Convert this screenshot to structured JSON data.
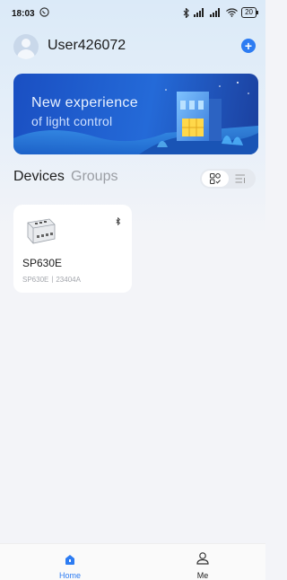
{
  "status_bar": {
    "time": "18:03",
    "battery": "20",
    "whatsapp_icon": "whatsapp-icon",
    "bluetooth_icon": "bluetooth-icon",
    "signal_icon": "signal-icon",
    "wifi_icon": "wifi-icon"
  },
  "header": {
    "username": "User426072",
    "add_label": "+"
  },
  "banner": {
    "line1": "New experience",
    "line2": "of light control"
  },
  "tabs": {
    "devices": "Devices",
    "groups": "Groups"
  },
  "devices": [
    {
      "name": "SP630E",
      "subtitle": "SP630E丨23404A"
    }
  ],
  "bottom_nav": {
    "home": "Home",
    "me": "Me"
  },
  "colors": {
    "accent": "#2d7cf2",
    "banner_blue": "#246ad8"
  }
}
